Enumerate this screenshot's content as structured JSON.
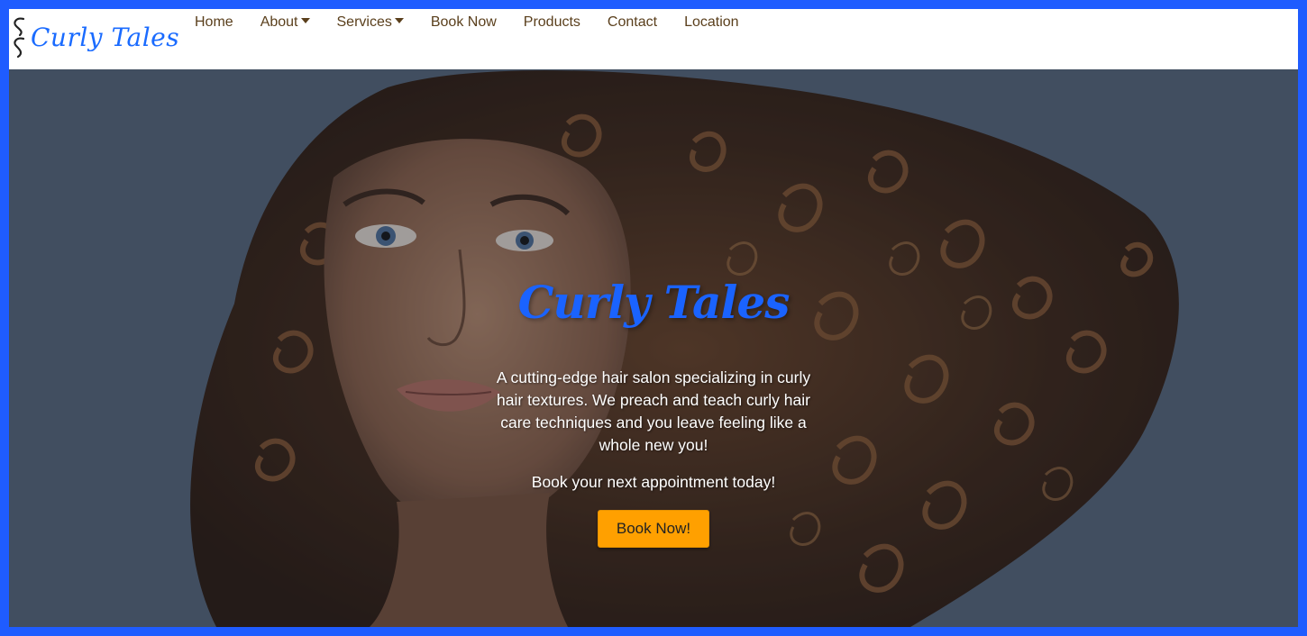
{
  "brand": {
    "name": "Curly Tales",
    "color": "#1a6bff"
  },
  "nav": {
    "items": [
      {
        "label": "Home",
        "dropdown": false
      },
      {
        "label": "About",
        "dropdown": true
      },
      {
        "label": "Services",
        "dropdown": true
      },
      {
        "label": "Book Now",
        "dropdown": false
      },
      {
        "label": "Products",
        "dropdown": false
      },
      {
        "label": "Contact",
        "dropdown": false
      },
      {
        "label": "Location",
        "dropdown": false
      }
    ]
  },
  "hero": {
    "title": "Curly Tales",
    "description": "A cutting-edge hair salon specializing in curly hair textures. We preach and teach curly hair care techniques and you leave feeling like a whole new you!",
    "cta_text": "Book your next appointment today!",
    "button_label": "Book Now!",
    "background_color": "#57667a",
    "button_color": "#ffa000"
  },
  "frame_color": "#1f5cff"
}
